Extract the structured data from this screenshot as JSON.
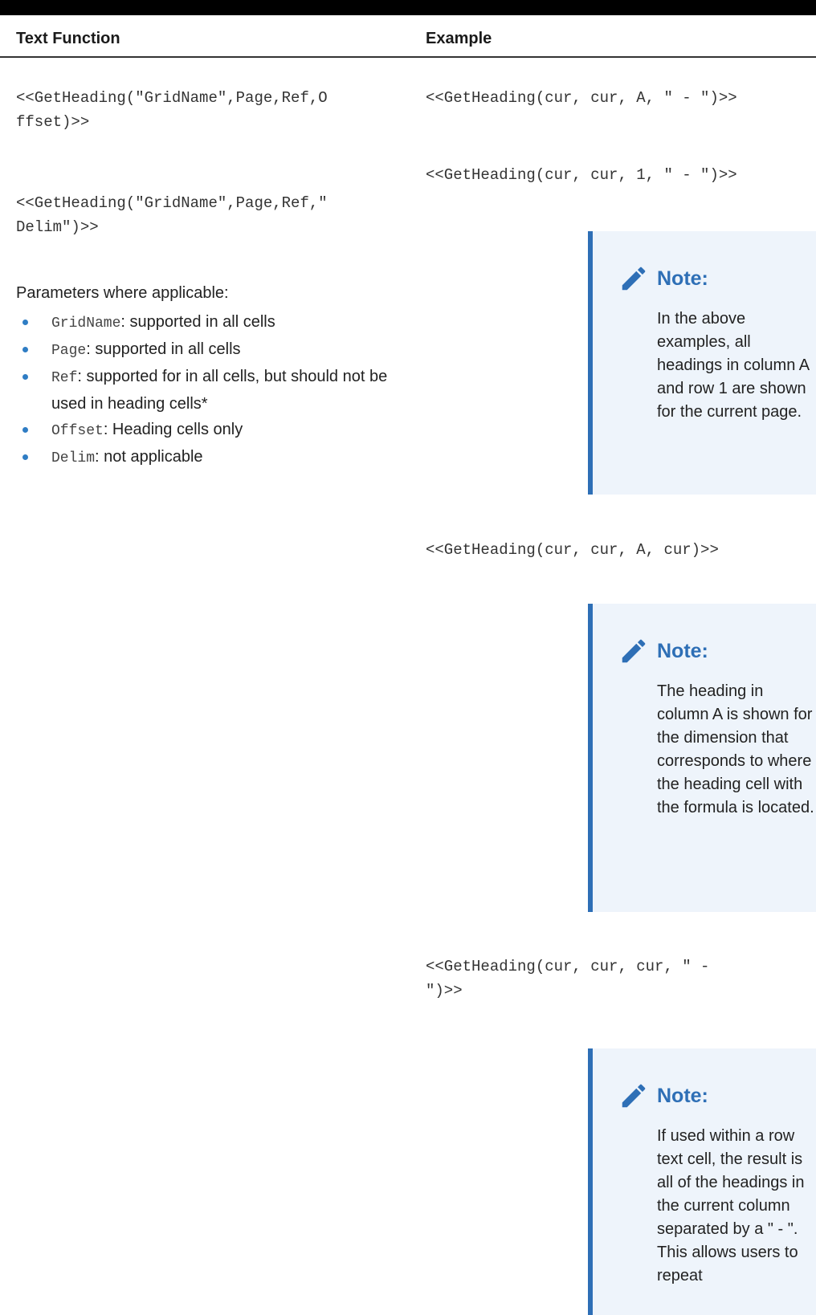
{
  "table": {
    "header_function": "Text Function",
    "header_example": "Example"
  },
  "syntax": {
    "line1a": "<<GetHeading(\"GridName\",Page,Ref,O",
    "line1b": "ffset)>>",
    "line2a": "<<GetHeading(\"GridName\",Page,Ref,\"",
    "line2b": "Delim\")>>"
  },
  "params": {
    "intro": "Parameters where applicable:",
    "items": [
      {
        "code": "GridName",
        "text": ": supported in all cells"
      },
      {
        "code": "Page",
        "text": ": supported in all cells"
      },
      {
        "code": "Ref",
        "text": ": supported for in all cells, but should not be used in heading cells*"
      },
      {
        "code": "Offset",
        "text": ": Heading cells only"
      },
      {
        "code": "Delim",
        "text": ": not applicable"
      }
    ]
  },
  "examples": {
    "ex1": "<<GetHeading(cur, cur, A, \" - \")>>",
    "ex2": "<<GetHeading(cur, cur, 1, \" - \")>>",
    "ex3": "<<GetHeading(cur, cur, A, cur)>>",
    "ex4a": "<<GetHeading(cur, cur, cur, \" -",
    "ex4b": "\")>>"
  },
  "notes": [
    {
      "title": "Note:",
      "body": "In the above examples, all headings in column A and row 1 are shown for the current page."
    },
    {
      "title": "Note:",
      "body": "The heading in column A is shown for the dimension that corresponds to where the heading cell with the formula is located."
    },
    {
      "title": "Note:",
      "body": "If used within a row text cell, the result is all of the headings in the current column separated by a \" - \". This allows users to repeat"
    }
  ],
  "colors": {
    "accent": "#2e6fb6",
    "note_bg": "#eef4fb",
    "bullet": "#2f7dc4"
  }
}
